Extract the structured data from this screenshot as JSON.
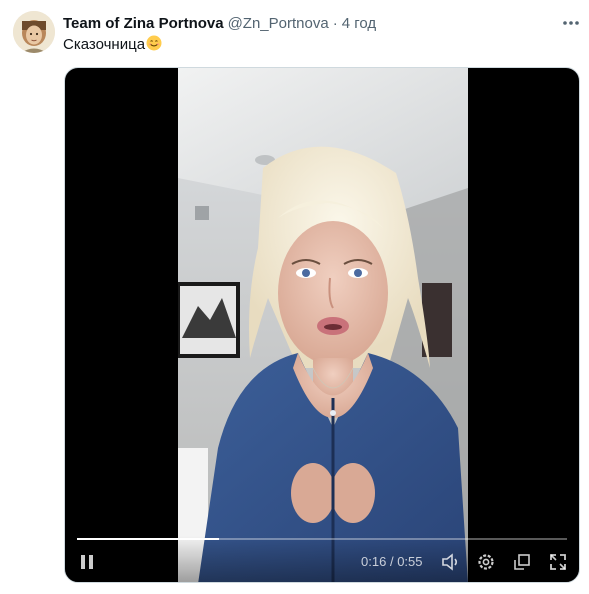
{
  "tweet": {
    "display_name": "Team of Zina Portnova",
    "handle": "@Zn_Portnova",
    "separator": "·",
    "time": "4 год",
    "text": "Сказочница",
    "emoji": "smiling-face-emoji"
  },
  "video": {
    "elapsed": "0:16",
    "duration": "0:55",
    "time_separator": "/",
    "progress": 0.29,
    "controls": [
      "pause-icon",
      "volume-icon",
      "settings-icon",
      "popout-icon",
      "fullscreen-icon"
    ]
  },
  "colors": {
    "accent_text": "#0f1419",
    "muted_text": "#536471",
    "media_bg": "#000000"
  }
}
